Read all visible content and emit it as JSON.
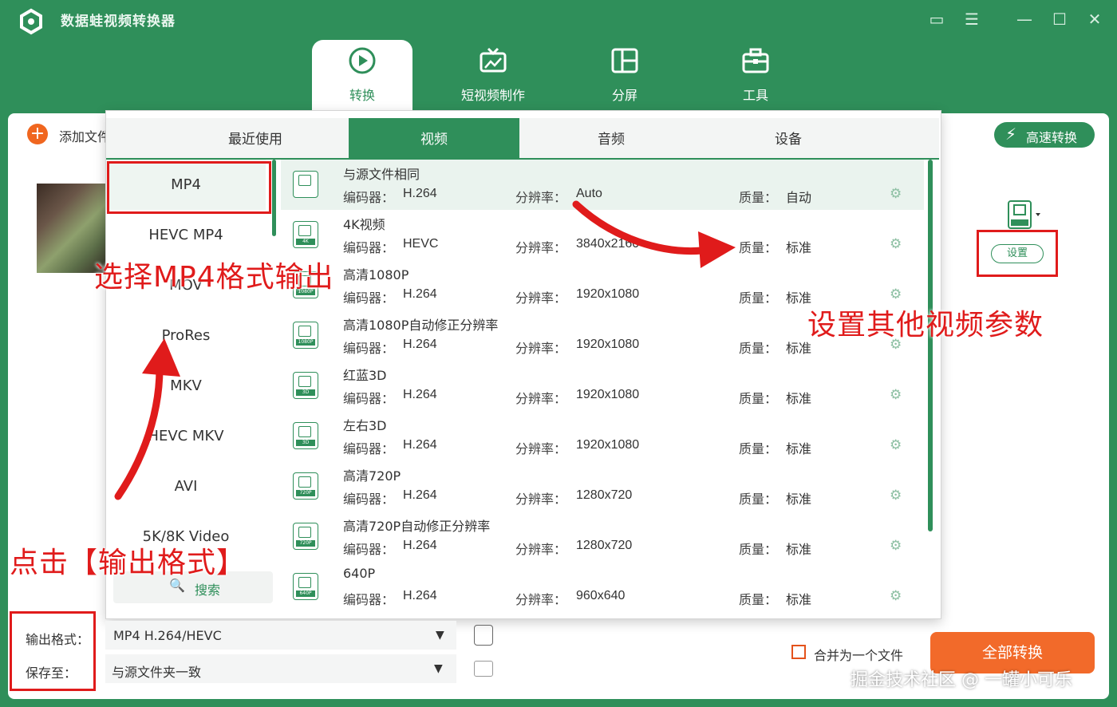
{
  "app": {
    "title": "数据蛙视频转换器"
  },
  "nav": [
    {
      "label": "转换",
      "icon": "convert-icon"
    },
    {
      "label": "短视频制作",
      "icon": "tv-icon"
    },
    {
      "label": "分屏",
      "icon": "split-screen-icon"
    },
    {
      "label": "工具",
      "icon": "toolbox-icon"
    }
  ],
  "main": {
    "add_file": "添加文件",
    "speed_btn": "高速转换",
    "settings_btn": "设置",
    "format_icon_tag": "MP4"
  },
  "popup": {
    "tabs": [
      "最近使用",
      "视频",
      "音频",
      "设备"
    ],
    "formats": [
      "MP4",
      "HEVC MP4",
      "MOV",
      "ProRes",
      "MKV",
      "HEVC MKV",
      "AVI",
      "5K/8K Video"
    ],
    "search": "搜索",
    "rows": [
      {
        "name": "与源文件相同",
        "codec": "H.264",
        "res": "Auto",
        "quality": "自动",
        "tag": ""
      },
      {
        "name": "4K视频",
        "codec": "HEVC",
        "res": "3840x2160",
        "quality": "标准",
        "tag": "4K"
      },
      {
        "name": "高清1080P",
        "codec": "H.264",
        "res": "1920x1080",
        "quality": "标准",
        "tag": "1080P"
      },
      {
        "name": "高清1080P自动修正分辨率",
        "codec": "H.264",
        "res": "1920x1080",
        "quality": "标准",
        "tag": "1080P"
      },
      {
        "name": "红蓝3D",
        "codec": "H.264",
        "res": "1920x1080",
        "quality": "标准",
        "tag": "3D"
      },
      {
        "name": "左右3D",
        "codec": "H.264",
        "res": "1920x1080",
        "quality": "标准",
        "tag": "3D"
      },
      {
        "name": "高清720P",
        "codec": "H.264",
        "res": "1280x720",
        "quality": "标准",
        "tag": "720P"
      },
      {
        "name": "高清720P自动修正分辨率",
        "codec": "H.264",
        "res": "1280x720",
        "quality": "标准",
        "tag": "720P"
      },
      {
        "name": "640P",
        "codec": "H.264",
        "res": "960x640",
        "quality": "标准",
        "tag": "640P"
      }
    ],
    "keys": {
      "codec": "编码器：",
      "res": "分辨率：",
      "quality": "质量："
    }
  },
  "bottom": {
    "output_label": "输出格式：",
    "output_value": "MP4 H.264/HEVC",
    "save_label": "保存至：",
    "save_value": "与源文件夹一致",
    "merge": "合并为一个文件",
    "convert_all": "全部转换"
  },
  "annotations": {
    "a1": "选择MP4格式输出",
    "a2": "设置其他视频参数",
    "a3": "点击【输出格式】"
  },
  "watermark": "掘金技术社区 @ 一罐小可乐",
  "colors": {
    "brand": "#2f8f5a",
    "accent": "#f26a2a",
    "annotation": "#e01b1b"
  }
}
